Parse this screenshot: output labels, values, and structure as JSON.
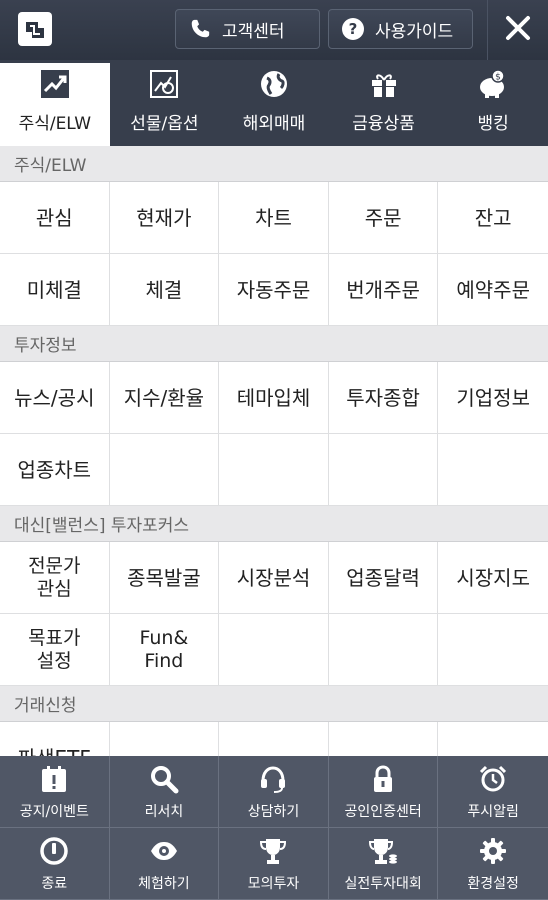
{
  "header": {
    "customer_center": "고객센터",
    "user_guide": "사용가이드"
  },
  "tabs": [
    {
      "label": "주식/ELW",
      "icon": "trend-chart-icon",
      "active": true
    },
    {
      "label": "선물/옵션",
      "icon": "chart-search-icon",
      "active": false
    },
    {
      "label": "해외매매",
      "icon": "globe-icon",
      "active": false
    },
    {
      "label": "금융상품",
      "icon": "gift-icon",
      "active": false
    },
    {
      "label": "뱅킹",
      "icon": "piggy-bank-icon",
      "active": false
    }
  ],
  "sections": [
    {
      "title": "주식/ELW",
      "items": [
        "관심",
        "현재가",
        "차트",
        "주문",
        "잔고",
        "미체결",
        "체결",
        "자동주문",
        "번개주문",
        "예약주문"
      ]
    },
    {
      "title": "투자정보",
      "items": [
        "뉴스/공시",
        "지수/환율",
        "테마입체",
        "투자종합",
        "기업정보",
        "업종차트",
        "",
        "",
        "",
        ""
      ]
    },
    {
      "title": "대신[밸런스] 투자포커스",
      "items": [
        "전문가\n관심",
        "종목발굴",
        "시장분석",
        "업종달력",
        "시장지도",
        "목표가\n설정",
        "Fun&\nFind",
        "",
        "",
        ""
      ]
    },
    {
      "title": "거래신청",
      "items": [
        "파생ETF",
        "",
        "",
        "",
        ""
      ]
    }
  ],
  "bottom_menu": [
    {
      "label": "공지/이벤트",
      "icon": "calendar-notice-icon"
    },
    {
      "label": "리서치",
      "icon": "search-icon"
    },
    {
      "label": "상담하기",
      "icon": "headset-icon"
    },
    {
      "label": "공인인증센터",
      "icon": "lock-icon"
    },
    {
      "label": "푸시알림",
      "icon": "alarm-clock-icon"
    },
    {
      "label": "종료",
      "icon": "power-icon"
    },
    {
      "label": "체험하기",
      "icon": "eye-icon"
    },
    {
      "label": "모의투자",
      "icon": "trophy-icon"
    },
    {
      "label": "실전투자대회",
      "icon": "trophy-coins-icon"
    },
    {
      "label": "환경설정",
      "icon": "gear-icon"
    }
  ]
}
